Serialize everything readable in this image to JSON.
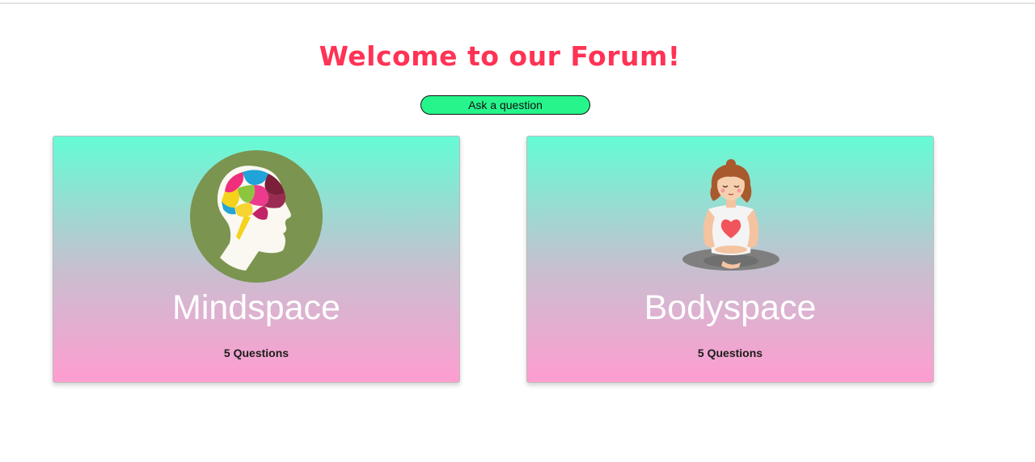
{
  "header": {
    "title": "Welcome to our Forum!",
    "ask_button_label": "Ask a question"
  },
  "cards": [
    {
      "title": "Mindspace",
      "question_count": "5 Questions",
      "icon": "brain-puzzle-head-icon"
    },
    {
      "title": "Bodyspace",
      "question_count": "5 Questions",
      "icon": "meditating-woman-icon"
    }
  ],
  "colors": {
    "title": "#ff3355",
    "button": "#26f58b",
    "card_gradient_top": "#64fcd4",
    "card_gradient_bottom": "#ff9dd0"
  }
}
